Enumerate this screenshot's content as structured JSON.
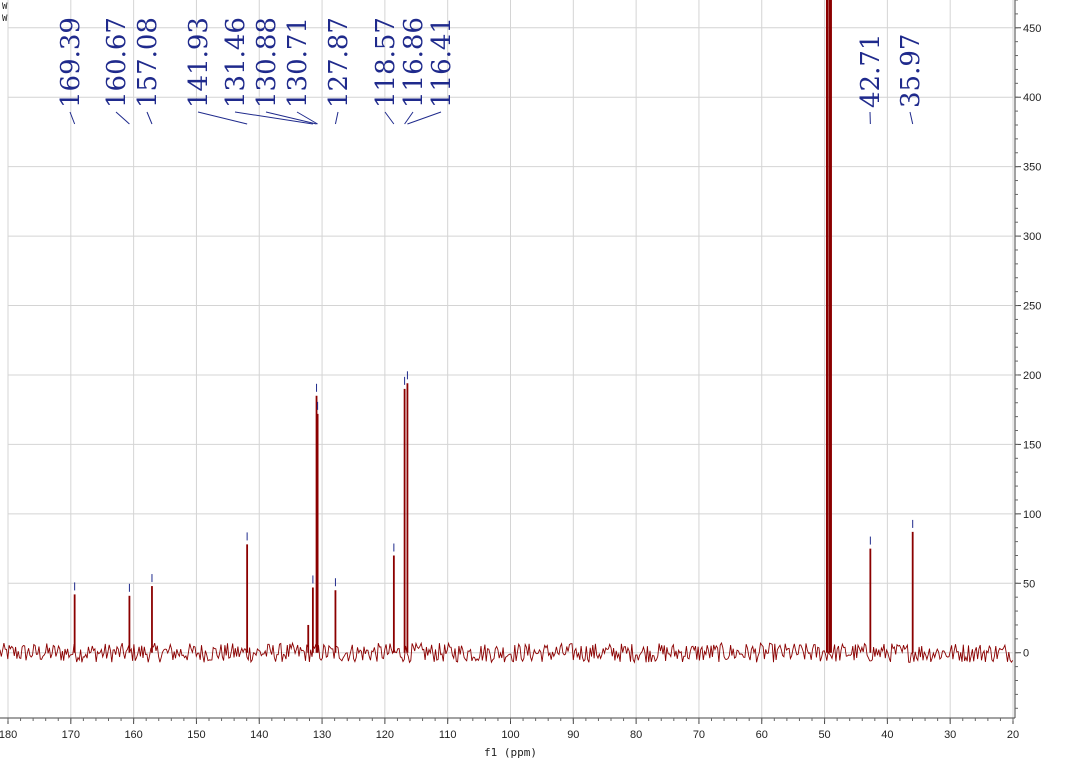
{
  "chart_data": {
    "type": "line",
    "title": "",
    "xlabel": "f1 (ppm)",
    "ylabel": "",
    "xlim": [
      180,
      20
    ],
    "ylim": [
      -47,
      470
    ],
    "x_reversed": true,
    "grid": true,
    "x_ticks": [
      180,
      170,
      160,
      150,
      140,
      130,
      120,
      110,
      100,
      90,
      80,
      70,
      60,
      50,
      40,
      30,
      20
    ],
    "y_ticks": [
      0,
      50,
      100,
      150,
      200,
      250,
      300,
      350,
      400,
      450
    ],
    "y_axis_side": "right",
    "line_color": "#8b0000",
    "label_color": "#1f2a8c",
    "noise_level": 7,
    "peaks": [
      {
        "ppm": 169.39,
        "height": 42
      },
      {
        "ppm": 160.67,
        "height": 41
      },
      {
        "ppm": 157.08,
        "height": 48
      },
      {
        "ppm": 141.93,
        "height": 78
      },
      {
        "ppm": 132.2,
        "height": 20
      },
      {
        "ppm": 131.46,
        "height": 47
      },
      {
        "ppm": 130.88,
        "height": 185
      },
      {
        "ppm": 130.71,
        "height": 172
      },
      {
        "ppm": 127.87,
        "height": 45
      },
      {
        "ppm": 118.57,
        "height": 70
      },
      {
        "ppm": 116.86,
        "height": 190
      },
      {
        "ppm": 116.41,
        "height": 194
      },
      {
        "ppm": 49.6,
        "height": 475
      },
      {
        "ppm": 49.2,
        "height": 475
      },
      {
        "ppm": 49.0,
        "height": 475
      },
      {
        "ppm": 42.71,
        "height": 75
      },
      {
        "ppm": 35.97,
        "height": 87
      }
    ],
    "peak_labels": [
      {
        "text": "169.39",
        "ppm": 169.39
      },
      {
        "text": "160.67",
        "ppm": 160.67
      },
      {
        "text": "157.08",
        "ppm": 157.08
      },
      {
        "text": "141.93",
        "ppm": 141.93
      },
      {
        "text": "131.46",
        "ppm": 131.46
      },
      {
        "text": "130.88",
        "ppm": 130.88
      },
      {
        "text": "130.71",
        "ppm": 130.71
      },
      {
        "text": "127.87",
        "ppm": 127.87
      },
      {
        "text": "118.57",
        "ppm": 118.57
      },
      {
        "text": "116.86",
        "ppm": 116.86
      },
      {
        "text": "116.41",
        "ppm": 116.41
      },
      {
        "text": "42.71",
        "ppm": 42.71
      },
      {
        "text": "35.97",
        "ppm": 35.97
      }
    ]
  }
}
